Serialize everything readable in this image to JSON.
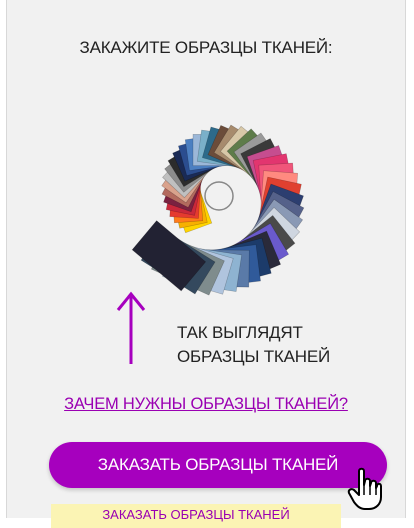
{
  "title": "ЗАКАЖИТЕ ОБРАЗЦЫ ТКАНЕЙ:",
  "caption": [
    "ТАК ВЫГЛЯДЯТ",
    "ОБРАЗЦЫ ТКАНЕЙ"
  ],
  "why_link": "ЗАЧЕМ НУЖНЫ ОБРАЗЦЫ ТКАНЕЙ?",
  "order_button": "ЗАКАЗАТЬ ОБРАЗЦЫ ТКАНЕЙ",
  "order_button_secondary": "ЗАКАЗАТЬ ОБРАЗЦЫ ТКАНЕЙ",
  "image": "fabric-samples-fan",
  "icons": {
    "arrow": "arrow-up-icon",
    "cursor": "hand-pointer-icon"
  },
  "colors": {
    "accent": "#a600be",
    "link": "#9a00b2",
    "secondary_bg": "#fbf4b4"
  }
}
